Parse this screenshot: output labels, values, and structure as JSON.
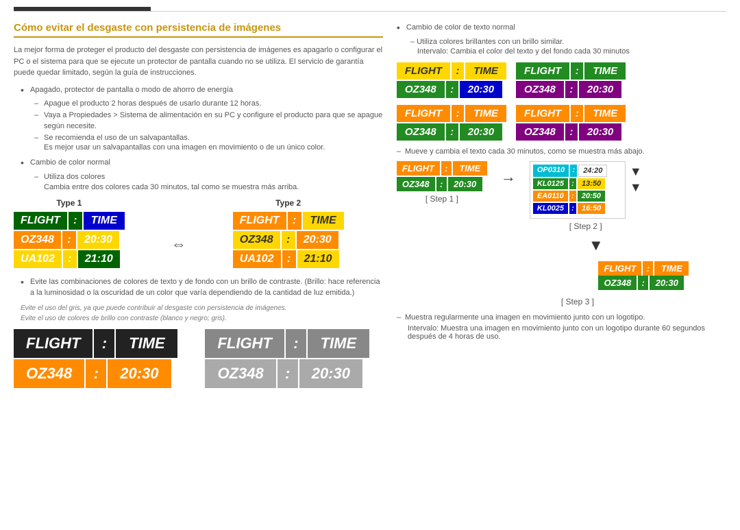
{
  "page": {
    "top_bar_color": "#333",
    "title": "Cómo evitar el desgaste con persistencia de imágenes",
    "intro_text": "La mejor forma de proteger el producto del desgaste con persistencia de imágenes es apagarlo o configurar el PC o el sistema para que se ejecute un protector de pantalla cuando no se utiliza. El servicio de garantía puede quedar limitado, según la guía de instrucciones.",
    "bullet1_main": "Apagado, protector de pantalla o modo de ahorro de energía",
    "bullet1_sub1": "Apague el producto 2 horas después de usarlo durante 12 horas.",
    "bullet1_sub2": "Vaya a Propiedades > Sistema de alimentación en su PC y configure el producto para que se apague según necesite.",
    "bullet1_sub3": "Se recomienda el uso de un salvapantallas.",
    "bullet1_note": "Es mejor usar un salvapantallas con una imagen en movimiento o de un único color.",
    "bullet2_main": "Cambio de color normal",
    "bullet2_sub1": "Utiliza dos colores",
    "bullet2_note": "Cambia entre dos colores cada 30 minutos, tal como se muestra más arriba.",
    "type1_label": "Type 1",
    "type2_label": "Type 2",
    "board": {
      "header_flight": "FLIGHT",
      "header_colon": ":",
      "header_time": "TIME",
      "row1_code": "OZ348",
      "row1_colon": ":",
      "row1_time": "20:30",
      "row2_code": "UA102",
      "row2_colon": ":",
      "row2_time": "21:10"
    },
    "warning1": "Evite las combinaciones de colores de texto y de fondo con un brillo de contraste. (Brillo: hace referencia a la luminosidad o la oscuridad de un color que varía dependiendo de la cantidad de luz emitida.)",
    "warning2": "Evite el uso del gris, ya que puede contribuir al desgaste con persistencia de imágenes.",
    "warning3": "Evite el uso de colores de brillo con contraste (blanco y negro; gris).",
    "right_bullet1": "Cambio de color de texto normal",
    "right_sub1": "Utiliza colores brillantes con un brillo similar.",
    "right_sub2": "Intervalo: Cambia el color del texto y del fondo cada 30 minutos",
    "right_dash1": "Mueve y cambia el texto cada 30 minutos, como se muestra más abajo.",
    "step1_label": "[ Step 1 ]",
    "step2_label": "[ Step 2 ]",
    "step3_label": "[ Step 3 ]",
    "right_dash2": "Muestra regularmente una imagen en movimiento junto con un logotipo.",
    "right_sub3": "Intervalo: Muestra una imagen en movimiento junto con un logotipo durante 60 segundos después de 4 horas de uso.",
    "scroll_data": [
      {
        "code": "OP0310",
        "colon": ":",
        "time": "24:20"
      },
      {
        "code": "KL0125",
        "colon": ":",
        "time": "13:50"
      },
      {
        "code": "EA0110",
        "colon": ":",
        "time": "20:50"
      },
      {
        "code": "KL0025",
        "colon": ":",
        "time": "16:50"
      }
    ]
  }
}
